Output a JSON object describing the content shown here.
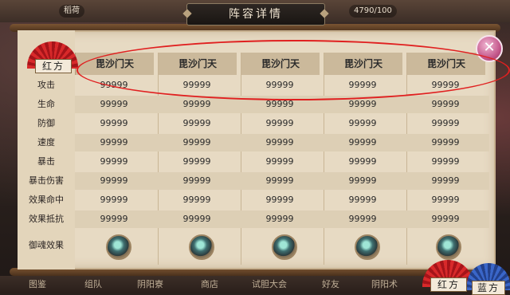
{
  "top": {
    "left_chip": "稻荷",
    "resource": "4790/100"
  },
  "title": "阵容详情",
  "team_badge": "红方",
  "columns": [
    "毘沙门天",
    "毘沙门天",
    "毘沙门天",
    "毘沙门天",
    "毘沙门天"
  ],
  "rows": [
    {
      "label": "攻击",
      "values": [
        "99999",
        "99999",
        "99999",
        "99999",
        "99999"
      ]
    },
    {
      "label": "生命",
      "values": [
        "99999",
        "99999",
        "99999",
        "99999",
        "99999"
      ]
    },
    {
      "label": "防御",
      "values": [
        "99999",
        "99999",
        "99999",
        "99999",
        "99999"
      ]
    },
    {
      "label": "速度",
      "values": [
        "99999",
        "99999",
        "99999",
        "99999",
        "99999"
      ]
    },
    {
      "label": "暴击",
      "values": [
        "99999",
        "99999",
        "99999",
        "99999",
        "99999"
      ]
    },
    {
      "label": "暴击伤害",
      "values": [
        "99999",
        "99999",
        "99999",
        "99999",
        "99999"
      ]
    },
    {
      "label": "效果命中",
      "values": [
        "99999",
        "99999",
        "99999",
        "99999",
        "99999"
      ]
    },
    {
      "label": "效果抵抗",
      "values": [
        "99999",
        "99999",
        "99999",
        "99999",
        "99999"
      ]
    }
  ],
  "soul_row_label": "御魂效果",
  "bottom_nav": [
    "图鉴",
    "组队",
    "阴阳寮",
    "商店",
    "试胆大会",
    "好友",
    "阴阳术"
  ],
  "bottom_badges": [
    "红方",
    "蓝方"
  ],
  "close_symbol": "✕"
}
